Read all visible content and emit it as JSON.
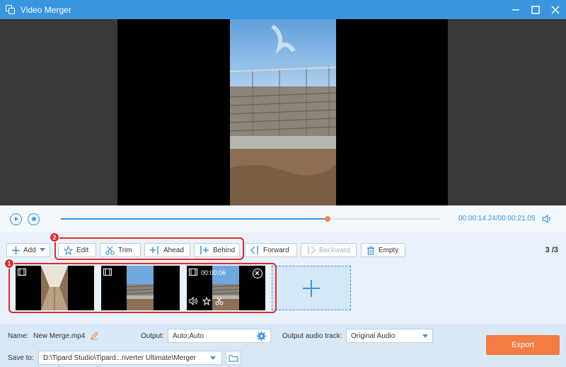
{
  "window": {
    "title": "Video Merger"
  },
  "player": {
    "current_time": "00:00:14.24",
    "total_time": "/00:00:21.05",
    "progress": 0.703
  },
  "toolbar": {
    "add_label": "Add",
    "edit_label": "Edit",
    "trim_label": "Trim",
    "ahead_label": "Ahead",
    "behind_label": "Behind",
    "forward_label": "Forward",
    "backward_label": "Backward",
    "empty_label": "Empty",
    "counter": "3 /3"
  },
  "markers": {
    "one": "1",
    "two": "2"
  },
  "clips": [
    {
      "kind": "corridor"
    },
    {
      "kind": "fence"
    },
    {
      "kind": "fence",
      "selected": true,
      "duration": "00:00:06"
    }
  ],
  "bottom": {
    "name_label": "Name:",
    "name_value": "New Merge.mp4",
    "output_label": "Output:",
    "output_value": "Auto;Auto",
    "audio_label": "Output audio track:",
    "audio_value": "Original Audio",
    "save_label": "Save to:",
    "save_value": "D:\\Tipard Studio\\Tipard...nverter Ultimate\\Merger",
    "export_label": "Export"
  },
  "colors": {
    "accent": "#3a95df",
    "export": "#f47b42",
    "annotation": "#e32a2a"
  }
}
